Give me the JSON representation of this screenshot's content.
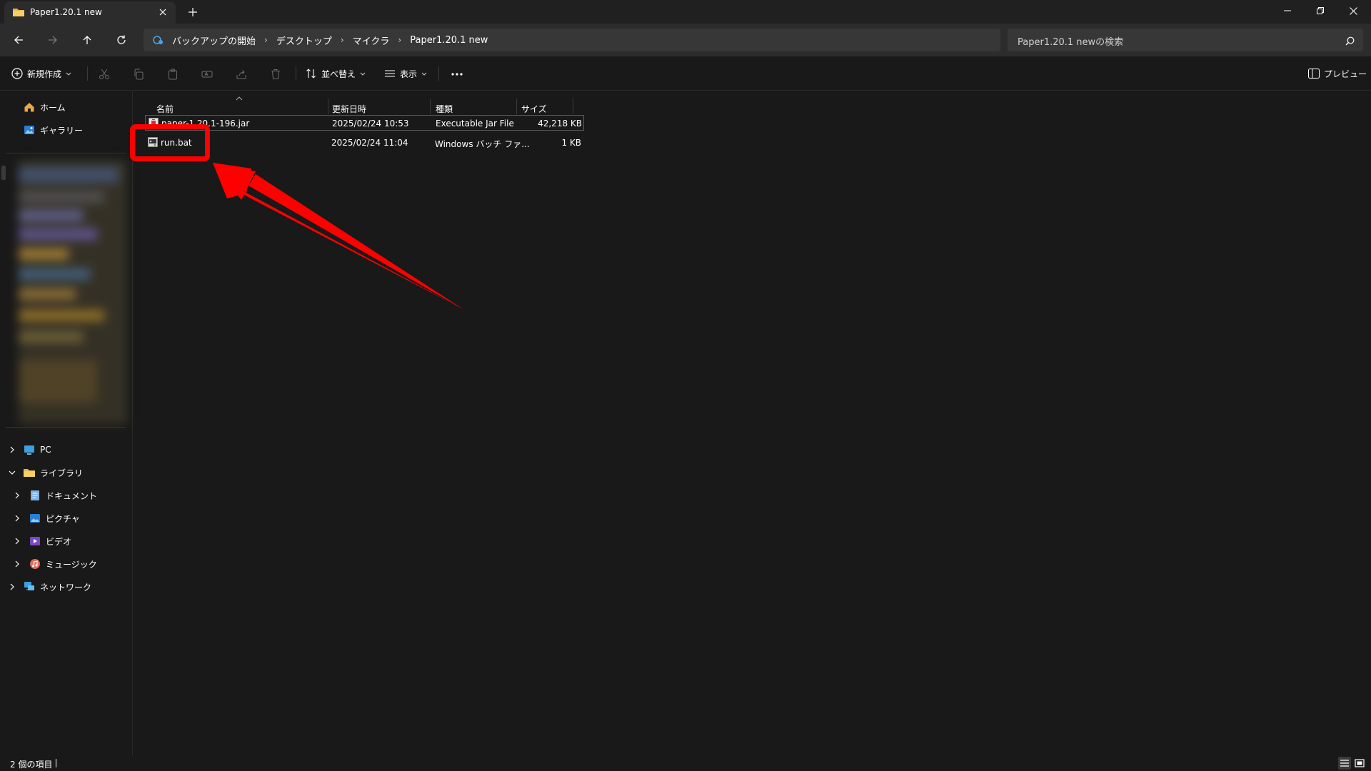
{
  "window": {
    "tab_title": "Paper1.20.1 new"
  },
  "address": {
    "breadcrumbs": [
      "バックアップの開始",
      "デスクトップ",
      "マイクラ",
      "Paper1.20.1 new"
    ],
    "search_placeholder": "Paper1.20.1 newの検索"
  },
  "toolbar": {
    "new_label": "新規作成",
    "sort_label": "並べ替え",
    "view_label": "表示",
    "preview_label": "プレビュー"
  },
  "sidebar": {
    "home": "ホーム",
    "gallery": "ギャラリー",
    "pc": "PC",
    "library": "ライブラリ",
    "documents": "ドキュメント",
    "pictures": "ピクチャ",
    "videos": "ビデオ",
    "music": "ミュージック",
    "network": "ネットワーク"
  },
  "columns": {
    "name": "名前",
    "modified": "更新日時",
    "type": "種類",
    "size": "サイズ"
  },
  "files": [
    {
      "name": "paper-1.20.1-196.jar",
      "modified": "2025/02/24 10:53",
      "type": "Executable Jar File",
      "size": "42,218 KB"
    },
    {
      "name": "run.bat",
      "modified": "2025/02/24 11:04",
      "type": "Windows バッチ ファ...",
      "size": "1 KB"
    }
  ],
  "status": {
    "item_count": "2 個の項目"
  },
  "colors": {
    "annotation": "#ff0000",
    "background": "#191919",
    "chrome": "#2c2c2c"
  }
}
